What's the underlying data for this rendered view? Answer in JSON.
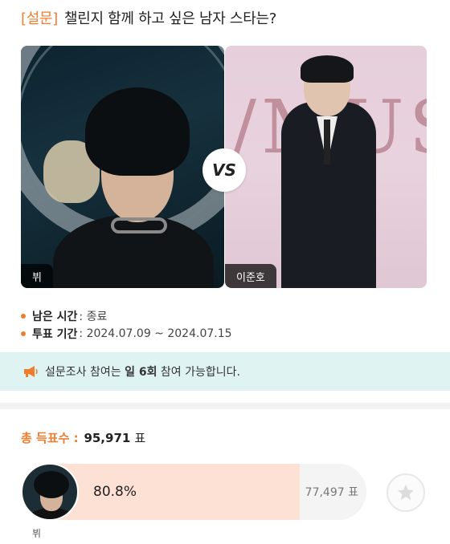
{
  "header": {
    "tag": "[설문]",
    "question": "챌린지 함께 하고 싶은 남자 스타는?"
  },
  "candidates": [
    {
      "name": "뷔"
    },
    {
      "name": "이준호"
    }
  ],
  "vs_label": "VS",
  "info": {
    "remaining_label": "남은 시간",
    "remaining_value": ": 종료",
    "period_label": "투표 기간",
    "period_value": ": 2024.07.09 ~ 2024.07.15"
  },
  "notice": {
    "prefix": "설문조사 참여는",
    "strong": "일 6회",
    "suffix": "참여 가능합니다."
  },
  "total": {
    "label": "총 득표수 :",
    "count": "95,971",
    "unit": "표"
  },
  "result": {
    "name": "뷔",
    "percent": "80.8%",
    "fill_fraction": 0.808,
    "votes": "77,497 표"
  },
  "colors": {
    "accent": "#f07d2e",
    "notice_bg": "#dff3f3",
    "bar_fill": "#fde1d5"
  },
  "icons": {
    "notice": "megaphone-icon",
    "star": "star-icon"
  }
}
